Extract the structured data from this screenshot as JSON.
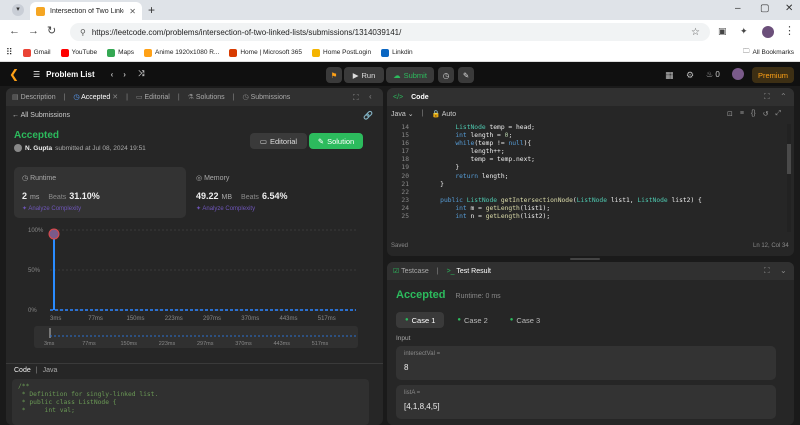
{
  "browser": {
    "tab_title": "Intersection of Two Linked Lists",
    "url": "https://leetcode.com/problems/intersection-of-two-linked-lists/submissions/1314039141/",
    "bookmarks": [
      {
        "label": "Gmail",
        "color": "#ea4335"
      },
      {
        "label": "YouTube",
        "color": "#ff0000"
      },
      {
        "label": "Maps",
        "color": "#34a853"
      },
      {
        "label": "Anime 1920x1080 R...",
        "color": "#ffa116"
      },
      {
        "label": "Home | Microsoft 365",
        "color": "#d83b01"
      },
      {
        "label": "Home PostLogin",
        "color": "#f4b400"
      },
      {
        "label": "Linkdin",
        "color": "#0a66c2"
      }
    ],
    "all_bookmarks": "All Bookmarks"
  },
  "appbar": {
    "problem_list": "Problem List",
    "run": "Run",
    "submit": "Submit",
    "streak": "0",
    "premium": "Premium"
  },
  "left": {
    "tabs": [
      "Description",
      "Accepted",
      "Editorial",
      "Solutions",
      "Submissions"
    ],
    "back": "All Submissions",
    "status": "Accepted",
    "user": "N. Gupta",
    "submitted": "submitted at Jul 08, 2024 19:51",
    "editorial_btn": "Editorial",
    "solution_btn": "Solution",
    "runtime": {
      "label": "Runtime",
      "value": "2",
      "unit": "ms",
      "beats_label": "Beats",
      "beats": "31.10%",
      "analyze": "Analyze Complexity"
    },
    "memory": {
      "label": "Memory",
      "value": "49.22",
      "unit": "MB",
      "beats_label": "Beats",
      "beats": "6.54%",
      "analyze": "Analyze Complexity"
    },
    "code_label": "Code",
    "lang": "Java"
  },
  "chart_data": {
    "type": "bar",
    "ylabels": [
      "100%",
      "50%",
      "0%"
    ],
    "categories": [
      "3ms",
      "77ms",
      "150ms",
      "223ms",
      "297ms",
      "370ms",
      "443ms",
      "517ms"
    ],
    "highlight": {
      "x": "2ms",
      "value": 100
    }
  },
  "code_preview": [
    "/**",
    " * Definition for singly-linked list.",
    " * public class ListNode {",
    " *     int val;"
  ],
  "editor": {
    "title": "Code",
    "lang": "Java",
    "auto": "Auto",
    "saved": "Saved",
    "cursor": "Ln 12, Col 34",
    "lines": [
      {
        "n": "14",
        "t": "        ListNode temp = head;"
      },
      {
        "n": "15",
        "t": "        int length = 0;"
      },
      {
        "n": "16",
        "t": "        while(temp != null){"
      },
      {
        "n": "17",
        "t": "            length++;"
      },
      {
        "n": "18",
        "t": "            temp = temp.next;"
      },
      {
        "n": "19",
        "t": "        }"
      },
      {
        "n": "20",
        "t": "        return length;"
      },
      {
        "n": "21",
        "t": "    }"
      },
      {
        "n": "22",
        "t": ""
      },
      {
        "n": "23",
        "t": "    public ListNode getIntersectionNode(ListNode list1, ListNode list2) {"
      },
      {
        "n": "24",
        "t": "        int m = getLength(list1);"
      },
      {
        "n": "25",
        "t": "        int n = getLength(list2);"
      }
    ]
  },
  "result": {
    "testcase_tab": "Testcase",
    "result_tab": "Test Result",
    "status": "Accepted",
    "runtime": "Runtime: 0 ms",
    "cases": [
      "Case 1",
      "Case 2",
      "Case 3"
    ],
    "input_label": "Input",
    "fields": [
      {
        "name": "intersectVal =",
        "value": "8"
      },
      {
        "name": "listA =",
        "value": "[4,1,8,4,5]"
      }
    ]
  }
}
